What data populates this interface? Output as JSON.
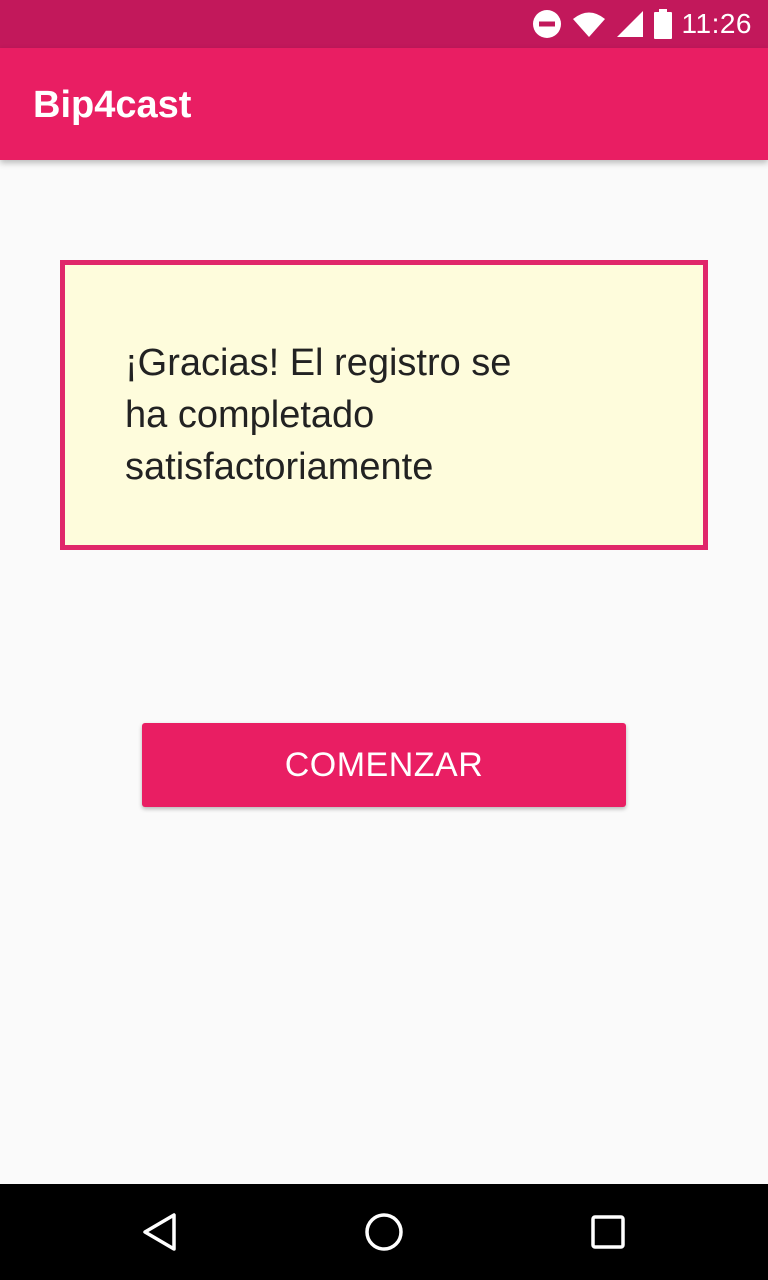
{
  "status_bar": {
    "time": "11:26",
    "icons": [
      "do-not-disturb-icon",
      "wifi-icon",
      "cell-signal-icon",
      "battery-icon"
    ],
    "background_color": "#c2185b"
  },
  "app_bar": {
    "title": "Bip4cast",
    "background_color": "#e91e63"
  },
  "message": {
    "text": "¡Gracias! El registro se ha completado satisfactoriamente",
    "border_color": "#e0276a",
    "background_color": "#fefcdc"
  },
  "actions": {
    "start_label": "COMENZAR",
    "button_color": "#e91e63"
  },
  "nav_bar": {
    "icons": [
      "back-icon",
      "home-icon",
      "recents-icon"
    ]
  }
}
